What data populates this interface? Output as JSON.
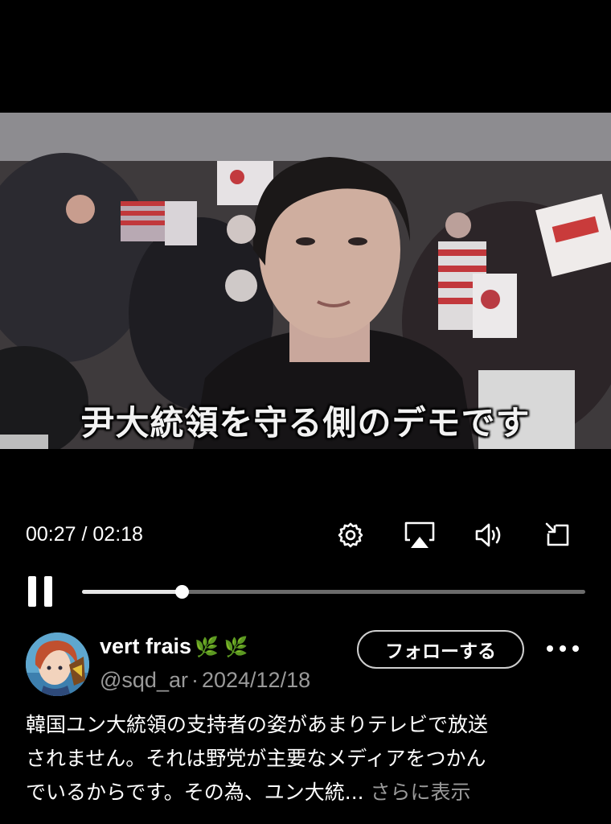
{
  "video": {
    "subtitle": "尹大統領を守る側のデモです"
  },
  "player": {
    "time_display": "00:27 / 02:18",
    "progress_fraction": 0.198,
    "icons": [
      "gear-icon",
      "airplay-icon",
      "volume-icon",
      "rotate-screen-icon",
      "pause-icon"
    ]
  },
  "post": {
    "display_name": "vert frais",
    "name_emoji": "🌿 🌿",
    "handle": "@sqd_ar",
    "separator": "·",
    "date": "2024/12/18",
    "follow_label": "フォローする",
    "text_lines": [
      "韓国ユン大統領の支持者の姿があまりテレビで放送",
      "されません。それは野党が主要なメディアをつかん",
      "でいるからです。その為、ユン大統..."
    ],
    "show_more": "さらに表示"
  },
  "colors": {
    "background": "#000000",
    "secondary_text": "#9a9a9a",
    "leaf": "#6fc54a"
  }
}
